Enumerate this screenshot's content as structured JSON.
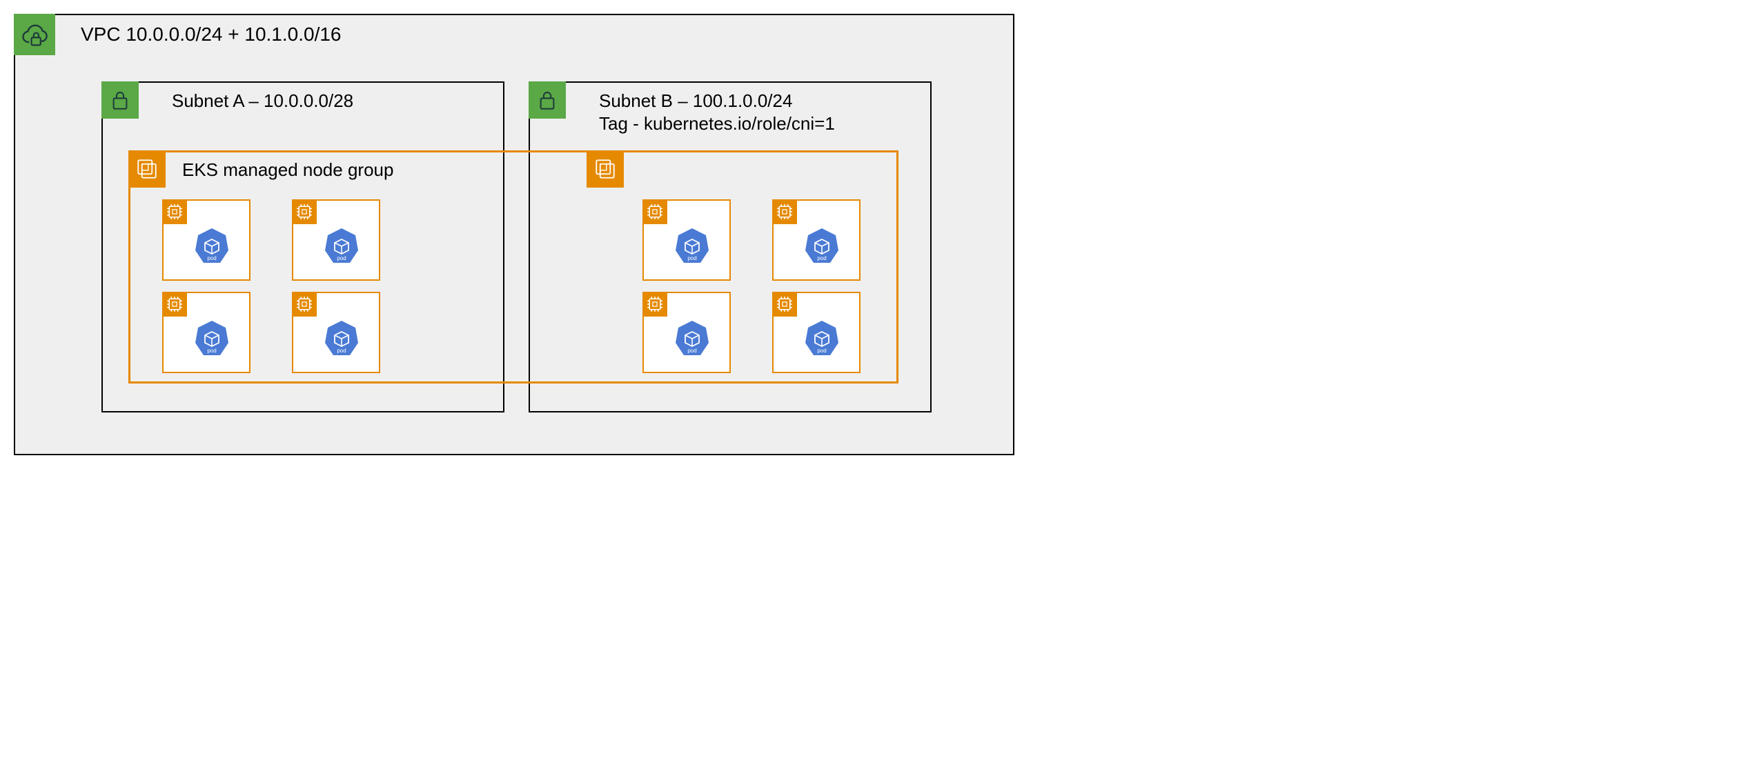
{
  "vpc": {
    "title": "VPC 10.0.0.0/24 + 10.1.0.0/16"
  },
  "subnets": [
    {
      "id": "A",
      "title": "Subnet A – 10.0.0.0/28",
      "tag": ""
    },
    {
      "id": "B",
      "title": "Subnet B – 100.1.0.0/24",
      "tag": "Tag -  kubernetes.io/role/cni=1"
    }
  ],
  "node_group": {
    "title": "EKS managed node group",
    "nodes_per_subnet": 4
  },
  "icons": {
    "vpc": "cloud-lock-icon",
    "subnet": "lock-icon",
    "nodegroup": "chip-stack-icon",
    "node": "chip-icon",
    "pod": "pod-icon"
  },
  "colors": {
    "badge_green": "#5aa846",
    "badge_orange": "#e58900",
    "pod_blue": "#4a7ad4",
    "background_grey": "#efefef",
    "border_black": "#000000"
  }
}
